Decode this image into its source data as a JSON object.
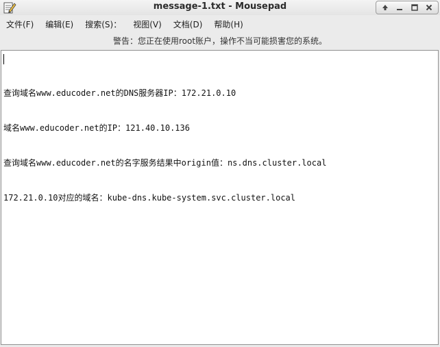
{
  "window": {
    "title": "message-1.txt - Mousepad",
    "icon": "text-editor-icon",
    "controls": [
      "arrow-up-icon",
      "minimize-icon",
      "maximize-icon",
      "close-icon"
    ]
  },
  "menubar": {
    "items": [
      {
        "label": "文件(F)"
      },
      {
        "label": "编辑(E)"
      },
      {
        "label": "搜索(S)："
      },
      {
        "label": "视图(V)"
      },
      {
        "label": "文档(D)"
      },
      {
        "label": "帮助(H)"
      }
    ]
  },
  "warning": {
    "text": "警告：您正在使用root账户，操作不当可能损害您的系统。"
  },
  "editor": {
    "lines": [
      "查询域名www.educoder.net的DNS服务器IP：172.21.0.10",
      "域名www.educoder.net的IP：121.40.10.136",
      "查询域名www.educoder.net的名字服务结果中origin值：ns.dns.cluster.local",
      "172.21.0.10对应的域名：kube-dns.kube-system.svc.cluster.local"
    ]
  }
}
